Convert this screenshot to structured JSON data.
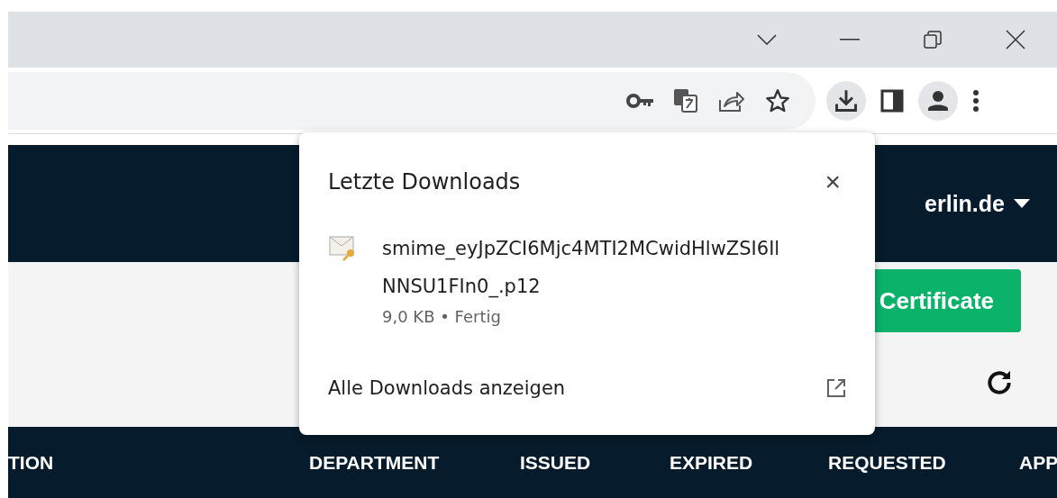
{
  "toolbar": {
    "download_active": true
  },
  "site": {
    "account": "erlin.de",
    "action_button": "Certificate"
  },
  "table": {
    "columns": [
      "TION",
      "DEPARTMENT",
      "ISSUED",
      "EXPIRED",
      "REQUESTED",
      "APP"
    ]
  },
  "downloads_popup": {
    "title": "Letzte Downloads",
    "close": "×",
    "items": [
      {
        "name_lines": [
          "smime_eyJpZCI6Mjc4MTI2MCwidHlwZSI6Il",
          "NNSU1FIn0_.p12"
        ],
        "size": "9,0 KB",
        "separator": "•",
        "status": "Fertig"
      }
    ],
    "show_all": "Alle Downloads anzeigen"
  }
}
